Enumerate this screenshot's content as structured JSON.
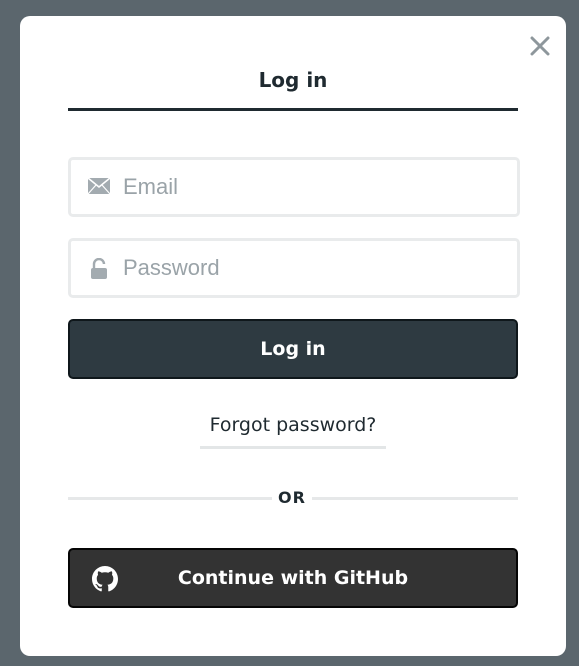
{
  "dialog": {
    "close_icon": "close-icon",
    "tab_label": "Log in",
    "email": {
      "placeholder": "Email",
      "value": "",
      "icon": "envelope-icon"
    },
    "password": {
      "placeholder": "Password",
      "value": "",
      "icon": "lock-icon"
    },
    "login_button": "Log in",
    "forgot_link": "Forgot password?",
    "divider_text": "OR",
    "github_button": {
      "label": "Continue with GitHub",
      "icon": "github-icon"
    }
  },
  "colors": {
    "backdrop": "#5b666d",
    "primary_button": "#2e3a41",
    "github_button": "#333333",
    "text": "#1f2a30",
    "placeholder": "#9aa3a8"
  }
}
